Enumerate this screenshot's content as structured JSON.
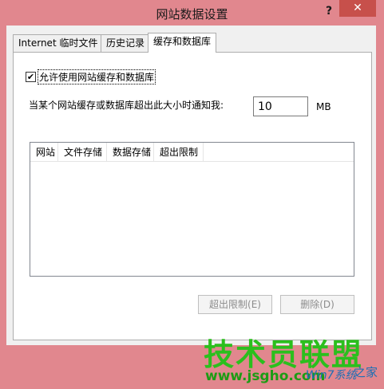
{
  "window": {
    "title": "网站数据设置",
    "help_label": "?",
    "close_label": "✕"
  },
  "tabs": [
    {
      "label": "Internet 临时文件",
      "active": false
    },
    {
      "label": "历史记录",
      "active": false
    },
    {
      "label": "缓存和数据库",
      "active": true
    }
  ],
  "cache_panel": {
    "allow_checkbox": {
      "label": "允许使用网站缓存和数据库",
      "checked": true,
      "mark": "✔"
    },
    "notify_label": "当某个网站缓存或数据库超出此大小时通知我:",
    "size_value": "10",
    "size_unit": "MB",
    "list_columns": [
      "网站",
      "文件存储",
      "数据存储",
      "超出限制"
    ],
    "buttons": {
      "exceed_limit": "超出限制(E)",
      "delete": "删除(D)"
    }
  },
  "watermark": {
    "brand": "技术员联盟",
    "url": "www.jsgho.com",
    "win_text": "Win7系统",
    "home_text": "之家"
  }
}
